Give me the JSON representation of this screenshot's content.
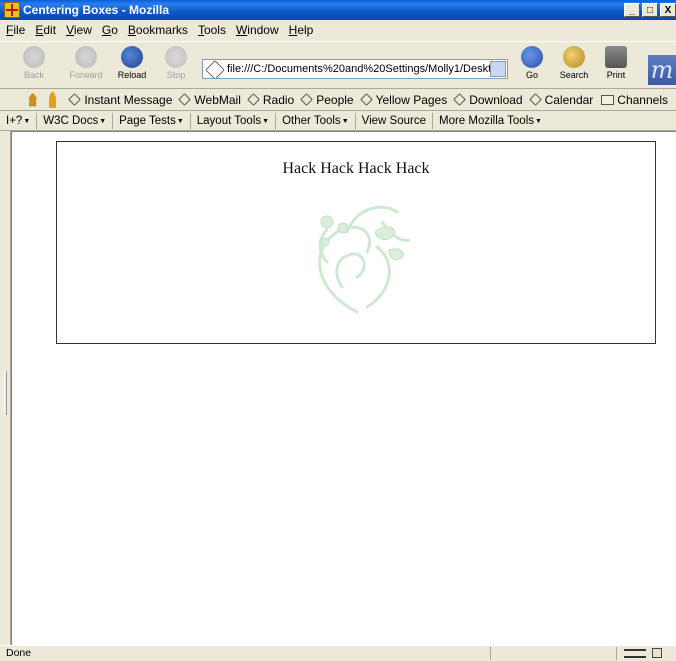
{
  "window": {
    "title": "Centering Boxes - Mozilla",
    "controls": [
      "_",
      "□",
      "X"
    ]
  },
  "menubar": {
    "items": [
      {
        "u": "F",
        "rest": "ile"
      },
      {
        "u": "E",
        "rest": "dit"
      },
      {
        "u": "V",
        "rest": "iew"
      },
      {
        "u": "G",
        "rest": "o"
      },
      {
        "u": "B",
        "rest": "ookmarks"
      },
      {
        "u": "T",
        "rest": "ools"
      },
      {
        "u": "W",
        "rest": "indow"
      },
      {
        "u": "H",
        "rest": "elp"
      }
    ]
  },
  "navbar": {
    "back": "Back",
    "forward": "Forward",
    "reload": "Reload",
    "stop": "Stop",
    "url": "file:///C:/Documents%20and%20Settings/Molly1/Deskt",
    "go": "Go",
    "search": "Search",
    "print": "Print"
  },
  "personal_toolbar": {
    "items": [
      "Instant Message",
      "WebMail",
      "Radio",
      "People",
      "Yellow Pages",
      "Download",
      "Calendar"
    ],
    "folder": "Channels"
  },
  "dev_toolbar": {
    "items": [
      "I+?",
      "W3C Docs",
      "Page Tests",
      "Layout Tools",
      "Other Tools",
      "View Source",
      "More Mozilla Tools"
    ],
    "dropdown": [
      true,
      true,
      true,
      true,
      true,
      false,
      true
    ]
  },
  "page": {
    "box_text": "Hack Hack Hack Hack"
  },
  "status": {
    "text": "Done"
  },
  "colors": {
    "title_bar": "#0a5fd8",
    "ornament": "#cfe8d2",
    "chrome": "#ece9d8"
  }
}
